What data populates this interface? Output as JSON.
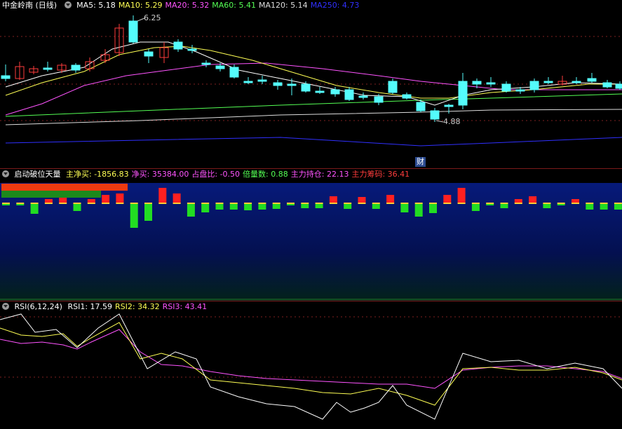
{
  "colors": {
    "up": "#ff3c3c",
    "down": "#54fcfc",
    "ma5": "#ffffff",
    "ma10": "#ffff54",
    "ma20": "#ff54ff",
    "ma60": "#54ff54",
    "ma120": "#dddddd",
    "ma250": "#3030ff",
    "neg": "#22dd22",
    "pos": "#ff2020"
  },
  "main": {
    "title": "中金岭南 (日线)",
    "ma": [
      {
        "label": "MA5: 5.18",
        "color": "#ffffff"
      },
      {
        "label": "MA10: 5.29",
        "color": "#ffff54"
      },
      {
        "label": "MA20: 5.32",
        "color": "#ff54ff"
      },
      {
        "label": "MA60: 5.41",
        "color": "#54ff54"
      },
      {
        "label": "MA120: 5.14",
        "color": "#dddddd"
      },
      {
        "label": "MA250: 4.73",
        "color": "#3030ff"
      }
    ],
    "high_label": "6.25",
    "low_label": "4.88",
    "event_label": "财"
  },
  "sub1": {
    "title": "启动破位天量",
    "items": [
      {
        "label": "主净买: -1856.83",
        "color": "#ffff54"
      },
      {
        "label": "净买: 35384.00",
        "color": "#ff54ff"
      },
      {
        "label": "占盘比: -0.50",
        "color": "#ff54ff"
      },
      {
        "label": "倍量数: 0.88",
        "color": "#54ff54"
      },
      {
        "label": "主力持仓: 22.13",
        "color": "#ff54ff"
      },
      {
        "label": "主力筹码: 36.41",
        "color": "#ff3c3c"
      }
    ],
    "bars": [
      0,
      0,
      -14,
      6,
      8,
      -10,
      6,
      12,
      14,
      -34,
      -24,
      22,
      14,
      -18,
      -12,
      -8,
      -8,
      -9,
      -8,
      -7,
      0,
      -6,
      -6,
      10,
      -7,
      9,
      -7,
      12,
      -12,
      -18,
      -13,
      12,
      22,
      -10,
      0,
      -6,
      6,
      10,
      -6,
      0,
      6,
      -8,
      -8,
      -8
    ]
  },
  "sub2": {
    "title": "RSI(6,12,24)",
    "items": [
      {
        "label": "RSI1: 17.59",
        "color": "#ffffff"
      },
      {
        "label": "RSI2: 34.32",
        "color": "#ffff54"
      },
      {
        "label": "RSI3: 43.41",
        "color": "#ff54ff"
      }
    ]
  }
}
